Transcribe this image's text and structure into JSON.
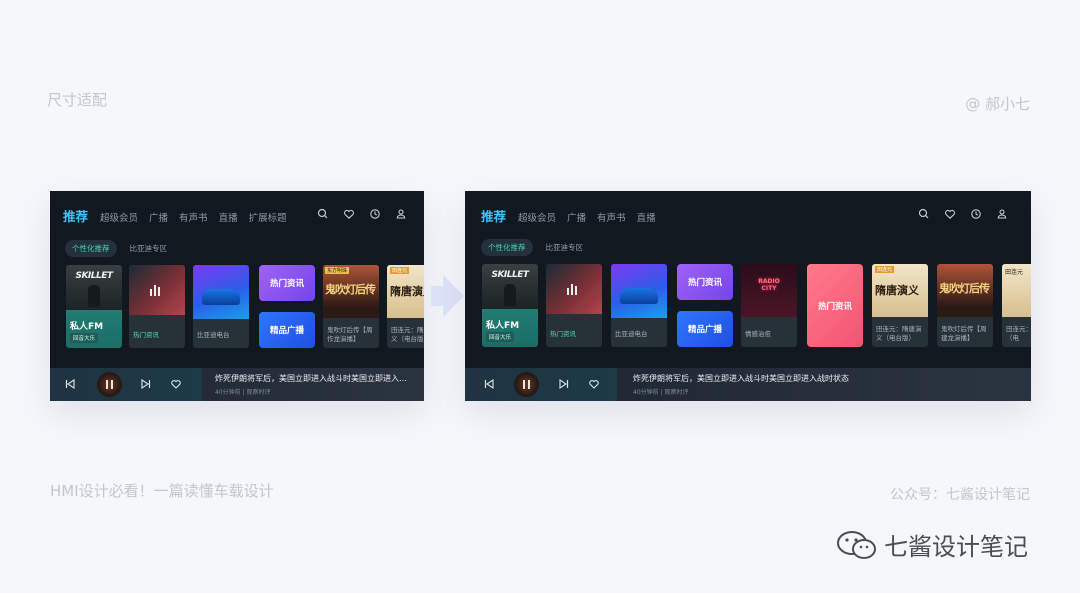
{
  "labels": {
    "top_left": "尺寸适配",
    "top_right": "@ 郝小七",
    "bottom_left": "HMI设计必看！一篇读懂车载设计",
    "bottom_right": "公众号：七酱设计笔记",
    "watermark": "七酱设计笔记"
  },
  "small": {
    "tabs": [
      "推荐",
      "超级会员",
      "广播",
      "有声书",
      "直播",
      "扩展标题"
    ],
    "subtabs": [
      "个性化推荐",
      "比亚迪专区"
    ],
    "cards": {
      "fm_title": "私人FM",
      "fm_tag": "回音大乐",
      "skillet": "SKILLET",
      "hot_news_card": "热门资讯",
      "byd": "比亚迪电台",
      "hot_news_btn": "热门资讯",
      "premium_btn": "精品广播",
      "ghost_top": "东方明珠",
      "ghost_title": "鬼吹灯后传",
      "ghost_caption": "鬼吹灯后传【周作龙演播】",
      "sui_top": "田连元",
      "sui_title": "隋唐演义",
      "sui_caption": "田连元：隋唐演义（电台版）"
    },
    "player": {
      "song": "炸死伊朗将军后，美国立即进入战斗时美国立即进入…",
      "meta": "40分钟前 | 观察时评"
    }
  },
  "large": {
    "tabs": [
      "推荐",
      "超级会员",
      "广播",
      "有声书",
      "直播"
    ],
    "subtabs": [
      "个性化推荐",
      "比亚迪专区"
    ],
    "cards": {
      "fm_title": "私人FM",
      "fm_tag": "回音大乐",
      "skillet": "SKILLET",
      "hot_news_card": "热门资讯",
      "byd": "比亚迪电台",
      "hot_news_btn": "热门资讯",
      "premium_btn": "精品广播",
      "radio_sign": "RADIO CITY",
      "healing": "情感治愈",
      "hot_news_pink": "热门资讯",
      "sui_top": "田连元",
      "sui_title": "隋唐演义",
      "sui_caption": "田连元：隋唐演义（电台版）",
      "ghost_title": "鬼吹灯后传",
      "ghost_caption": "鬼吹灯后传【周建龙演播】",
      "last_top": "田连元",
      "last_caption": "田连元：演义（电"
    },
    "player": {
      "song": "炸死伊朗将军后，美国立即进入战斗时美国立即进入战时状态",
      "meta": "40分钟前 | 观察时评"
    }
  },
  "colors": {
    "accent": "#3cc4ff",
    "selected_subtab": "#43d6b0",
    "premium_blue": "#2f6bff",
    "hot_purple": "#8e55f1",
    "hot_pink": "#ff6a7e"
  }
}
